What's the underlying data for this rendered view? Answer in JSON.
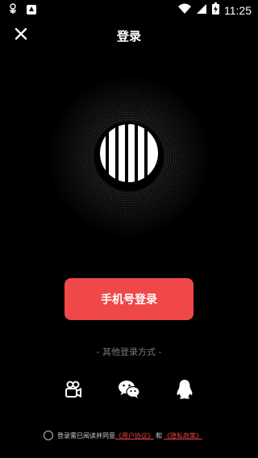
{
  "status_bar": {
    "time": "11:25",
    "left_icons": [
      "bug-icon",
      "upload-icon"
    ],
    "right_icons": [
      "wifi-icon",
      "signal-icon",
      "battery-charging-icon"
    ]
  },
  "header": {
    "title": "登录",
    "close_icon": "close-icon"
  },
  "main": {
    "logo_icon": "sound-wave-logo-icon",
    "phone_login_label": "手机号登录",
    "other_methods_label": "- 其他登录方式 -",
    "social_icons": [
      "video-camera-icon",
      "wechat-icon",
      "qq-icon"
    ]
  },
  "agreement": {
    "prefix": "登录需已阅读并同意",
    "user_agreement": "《用户协议》",
    "conjunction": "和",
    "privacy_policy": "《隐私政策》"
  },
  "colors": {
    "background": "#000000",
    "accent": "#f04848",
    "link": "#e84444"
  }
}
